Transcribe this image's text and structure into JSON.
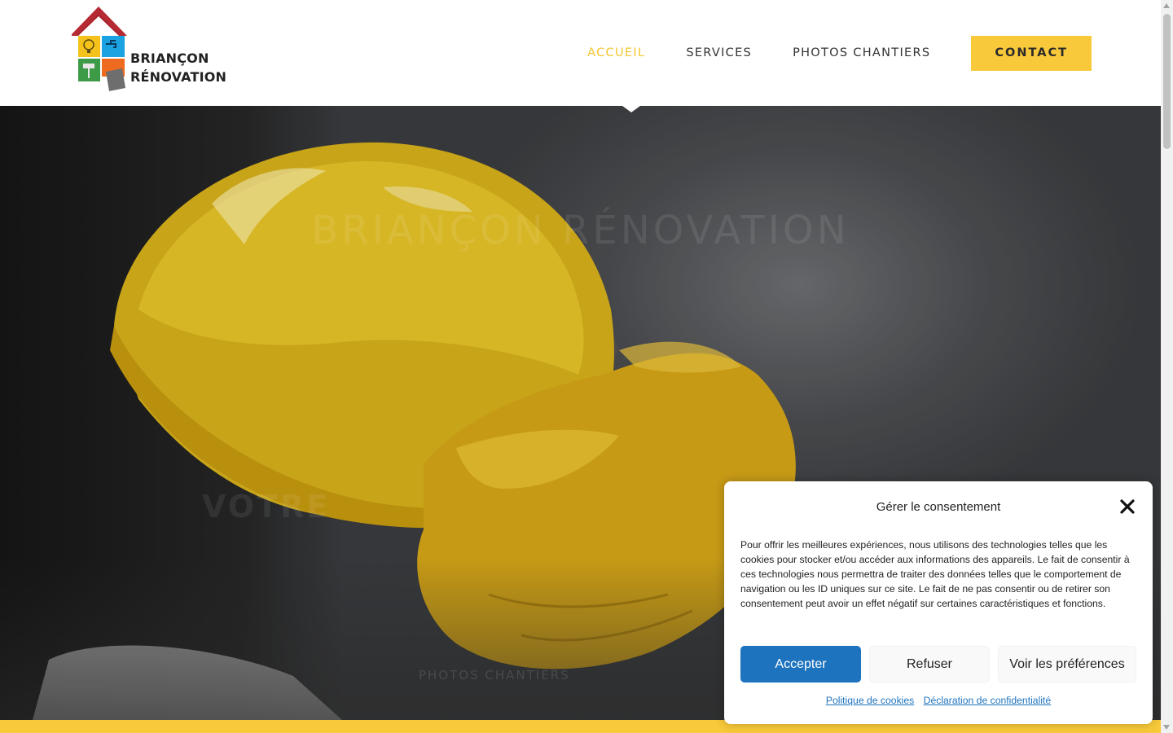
{
  "brand": {
    "logo_line1": "BRIANÇON",
    "logo_line2": "RÉNOVATION"
  },
  "nav": {
    "items": [
      {
        "label": "ACCUEIL",
        "active": true
      },
      {
        "label": "SERVICES",
        "active": false
      },
      {
        "label": "PHOTOS CHANTIERS",
        "active": false
      }
    ],
    "contact_label": "CONTACT"
  },
  "hero": {
    "title": "BRIANÇON RÉNOVATION",
    "subtitle": "VOTRE",
    "photos_link": "PHOTOS CHANTIERS"
  },
  "consent": {
    "title": "Gérer le consentement",
    "text": "Pour offrir les meilleures expériences, nous utilisons des technologies telles que les cookies pour stocker et/ou accéder aux informations des appareils. Le fait de consentir à ces technologies nous permettra de traiter des données telles que le comportement de navigation ou les ID uniques sur ce site. Le fait de ne pas consentir ou de retirer son consentement peut avoir un effet négatif sur certaines caractéristiques et fonctions.",
    "accept_label": "Accepter",
    "refuse_label": "Refuser",
    "prefs_label": "Voir les préférences",
    "cookie_policy_label": "Politique de cookies",
    "privacy_label": "Déclaration de confidentialité"
  },
  "colors": {
    "accent_yellow": "#f8c93a",
    "active_nav": "#f3c62f",
    "accept_blue": "#1e73be",
    "roof_red": "#a8222b"
  },
  "icons": [
    "close-icon",
    "lightbulb-icon",
    "faucet-icon",
    "paint-roller-icon",
    "tile-icon",
    "scroll-up-arrow-icon",
    "scroll-down-arrow-icon"
  ]
}
